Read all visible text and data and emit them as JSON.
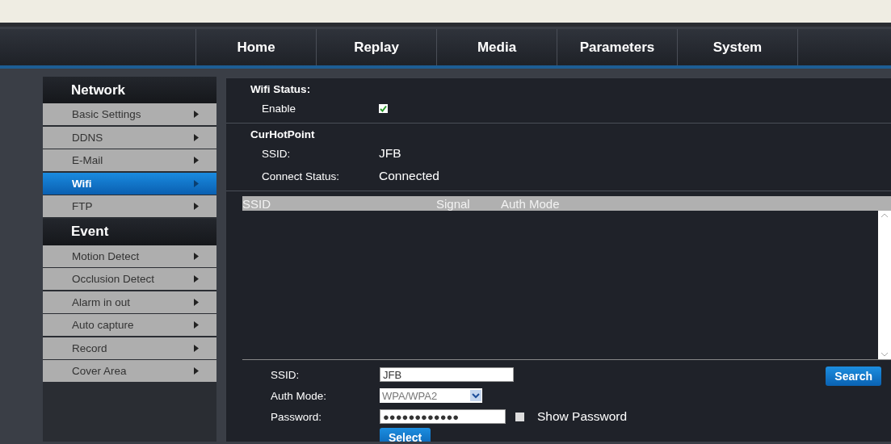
{
  "nav": {
    "tabs": [
      "Home",
      "Replay",
      "Media",
      "Parameters",
      "System"
    ]
  },
  "sidebar": {
    "sections": [
      {
        "title": "Network",
        "items": [
          {
            "label": "Basic Settings",
            "selected": false
          },
          {
            "label": "DDNS",
            "selected": false
          },
          {
            "label": "E-Mail",
            "selected": false
          },
          {
            "label": "Wifi",
            "selected": true
          },
          {
            "label": "FTP",
            "selected": false
          }
        ]
      },
      {
        "title": "Event",
        "items": [
          {
            "label": "Motion Detect",
            "selected": false
          },
          {
            "label": "Occlusion Detect",
            "selected": false
          },
          {
            "label": "Alarm in out",
            "selected": false
          },
          {
            "label": "Auto capture",
            "selected": false
          },
          {
            "label": "Record",
            "selected": false
          },
          {
            "label": "Cover Area",
            "selected": false
          }
        ]
      }
    ]
  },
  "wifi_status": {
    "title": "Wifi Status:",
    "enable_label": "Enable",
    "enabled": true
  },
  "cur_hot_point": {
    "title": "CurHotPoint",
    "rows": [
      {
        "label": "SSID:",
        "value": "JFB"
      },
      {
        "label": "Connect Status:",
        "value": "Connected"
      }
    ]
  },
  "network_list": {
    "columns": [
      "SSID",
      "Signal",
      "Auth Mode"
    ]
  },
  "form": {
    "ssid_label": "SSID:",
    "ssid_value": "JFB",
    "auth_label": "Auth Mode:",
    "auth_value": "WPA/WPA2",
    "password_label": "Password:",
    "password_value": "●●●●●●●●●●●●",
    "show_password_label": "Show Password",
    "show_password": false,
    "search_button": "Search",
    "select_button": "Select"
  }
}
